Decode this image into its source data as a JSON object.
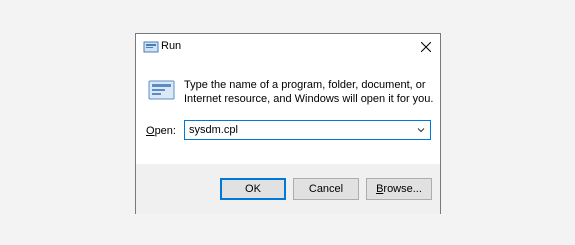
{
  "dialog": {
    "title": "Run",
    "message": "Type the name of a program, folder, document, or Internet resource, and Windows will open it for you.",
    "open_label_accel": "O",
    "open_label_rest": "pen:",
    "input_value": "sysdm.cpl",
    "ok_label": "OK",
    "cancel_label": "Cancel",
    "browse_accel": "B",
    "browse_rest": "rowse..."
  },
  "icons": {
    "title": "run-icon",
    "close": "close-icon",
    "dropdown": "chevron-down-icon",
    "large": "run-icon-large"
  },
  "colors": {
    "accent": "#0078d7",
    "footer": "#f0f0f0",
    "button": "#e1e1e1"
  }
}
